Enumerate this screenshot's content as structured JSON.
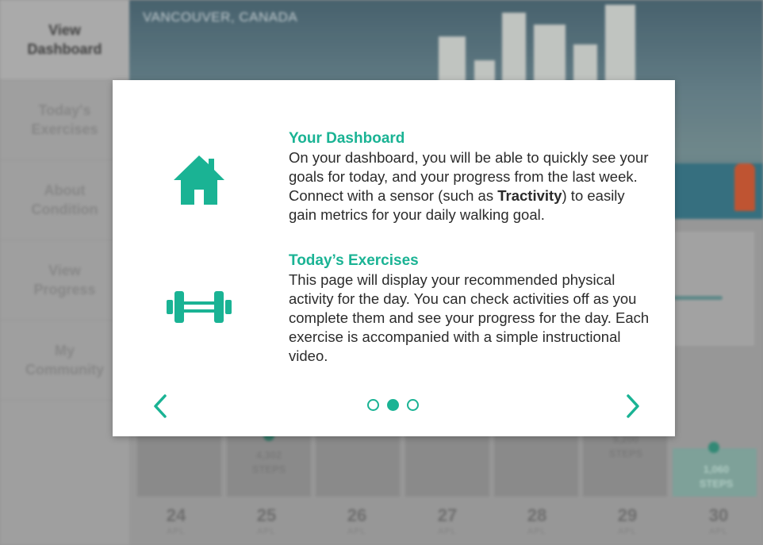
{
  "sidebar": {
    "items": [
      {
        "label": "View\nDashboard",
        "active": true
      },
      {
        "label": "Today's\nExercises",
        "active": false
      },
      {
        "label": "About\nCondition",
        "active": false
      },
      {
        "label": "View\nProgress",
        "active": false
      },
      {
        "label": "My\nCommunity",
        "active": false
      }
    ]
  },
  "hero": {
    "caption": "VANCOUVER, CANADA"
  },
  "calendar": {
    "days": [
      {
        "date": "24",
        "month": "APL",
        "steps": "",
        "steps_unit": ""
      },
      {
        "date": "25",
        "month": "APL",
        "steps": "4,302",
        "steps_unit": "STEPS"
      },
      {
        "date": "26",
        "month": "APL",
        "steps": "",
        "steps_unit": ""
      },
      {
        "date": "27",
        "month": "APL",
        "steps": "",
        "steps_unit": ""
      },
      {
        "date": "28",
        "month": "APL",
        "steps": "",
        "steps_unit": ""
      },
      {
        "date": "29",
        "month": "APL",
        "steps": "5,200",
        "steps_unit": "STEPS"
      },
      {
        "date": "30",
        "month": "APL",
        "steps": "1,060",
        "steps_unit": "STEPS"
      }
    ]
  },
  "modal": {
    "sections": [
      {
        "icon": "home-icon",
        "title": "Your Dashboard",
        "text_before": "On your dashboard, you will be able to quickly see your goals for today, and your progress from the last week. Connect with a sensor (such as ",
        "text_bold": "Tractivity",
        "text_after": ") to easily gain metrics for your daily walking goal."
      },
      {
        "icon": "dumbbell-icon",
        "title": "Today’s Exercises",
        "text": "This page will display your recommended physical activity for the day. You can check activities off as you complete them and see your progress for the day. Each exercise is accompanied with a simple instructional video."
      }
    ],
    "pagination": {
      "total": 3,
      "current": 2
    },
    "accent_color": "#1ab394"
  }
}
